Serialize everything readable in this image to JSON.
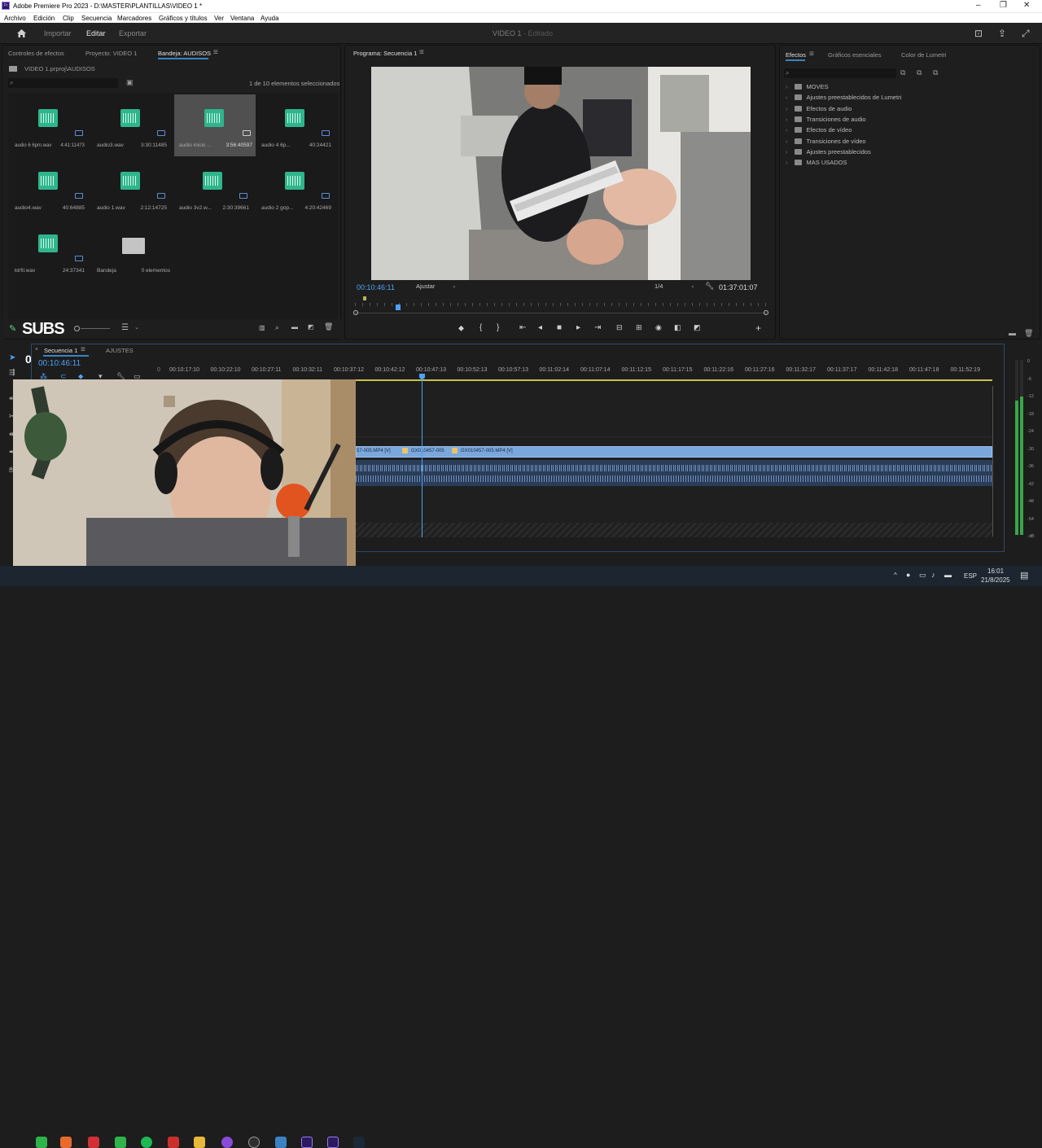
{
  "window": {
    "title": "Adobe Premiere Pro 2023 - D:\\MASTER\\PLANTILLAS\\VIDEO 1 *",
    "logo": "Pr"
  },
  "menu": [
    "Archivo",
    "Edición",
    "Clip",
    "Secuencia",
    "Marcadores",
    "Gráficos y títulos",
    "Ver",
    "Ventana",
    "Ayuda"
  ],
  "header": {
    "tabs": [
      "Importar",
      "Editar",
      "Exportar"
    ],
    "active": "Editar",
    "doc_title": "VIDEO 1",
    "doc_status": " - Editado"
  },
  "project_panel": {
    "tabs": [
      "Controles de efectos",
      "Proyecto: VIDEO 1",
      "Bandeja: AUDISOS"
    ],
    "path": "VIDEO 1.prproj\\AUDISOS",
    "selection_count": "1 de 10 elementos seleccionados",
    "items": [
      {
        "name": "audio 6 6pm.wav",
        "duration": "4:41:11473"
      },
      {
        "name": "audio3.wav",
        "duration": "3:30:11485"
      },
      {
        "name": "audio inicio ...",
        "duration": "3:56:40597"
      },
      {
        "name": "audio 4 6p...",
        "duration": "40:24421"
      },
      {
        "name": "audio4.wav",
        "duration": "40:64885"
      },
      {
        "name": "audio 1.wav",
        "duration": "2:12:14725"
      },
      {
        "name": "audio 3v2.w...",
        "duration": "2:30:39661"
      },
      {
        "name": "audio 2 gop...",
        "duration": "4:20:42469"
      },
      {
        "name": "ktrfil.wav",
        "duration": "24:37341"
      },
      {
        "name": "Bandeja",
        "duration": "0 elementos"
      }
    ]
  },
  "program_monitor": {
    "title": "Programa: Secuencia 1",
    "timecode": "00:10:46:11",
    "fit": "Ajustar",
    "quality": "1/4",
    "duration": "01:37:01:07"
  },
  "effects_panel": {
    "tabs": [
      "Efectos",
      "Gráficos esenciales",
      "Color de Lumetri"
    ],
    "folders": [
      "MOVES",
      "Ajustes preestablecidos de Lumetri",
      "Efectos de audio",
      "Transiciones de audio",
      "Efectos de vídeo",
      "Transiciones de vídeo",
      "Ajustes preestablecidos",
      "MAS USADOS"
    ]
  },
  "overlay": {
    "subs_label": "SUBS",
    "counter": "0"
  },
  "timeline": {
    "tabs": [
      "Secuencia 1",
      "AJUSTES"
    ],
    "timecode": "00:10:46:11",
    "ruler_zero": "0",
    "ruler": [
      "00:10:17:10",
      "00:10:22:10",
      "00:10:27:11",
      "00:10:32:11",
      "00:10:37:12",
      "00:10:42:12",
      "00:10:47:13",
      "00:10:52:13",
      "00:10:57:13",
      "00:11:02:14",
      "00:11:07:14",
      "00:11:12:15",
      "00:11:17:15",
      "00:11:22:16",
      "00:11:27:16",
      "00:11:32:17",
      "00:11:37:17",
      "00:11:42:18",
      "00:11:47:18",
      "00:11:52:19"
    ],
    "clips": [
      "57-005.MP4 [V]",
      "GX010457-005",
      "GX010457-005.MP4 [V]"
    ],
    "meter_scale": [
      "0",
      "-6",
      "-12",
      "-18",
      "-24",
      "-30",
      "-36",
      "-42",
      "-48",
      "-54",
      "-dB"
    ]
  },
  "taskbar": {
    "lang": "ESP",
    "time": "16:01",
    "date": "21/8/2025"
  },
  "colors": {
    "accent": "#3b82c4",
    "clip_video": "#7aa7dc",
    "audio_icon": "#2fb58c"
  }
}
